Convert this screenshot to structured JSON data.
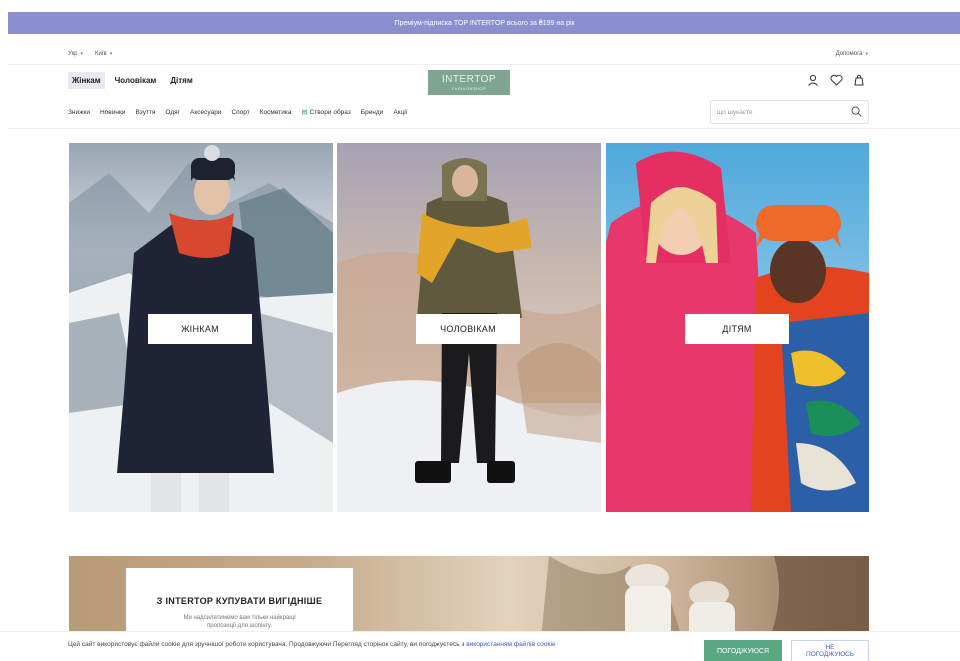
{
  "promo_bar": {
    "text": "Преміум-підписка TOP INTERTOP всього за ₴199 на рік"
  },
  "topbar": {
    "language": "Укр",
    "city": "Київ",
    "help": "Допомога"
  },
  "gender_nav": [
    {
      "label": "Жінкам",
      "active": true
    },
    {
      "label": "Чоловікам",
      "active": false
    },
    {
      "label": "Дітям",
      "active": false
    }
  ],
  "logo": {
    "main": "INTERTOP",
    "sub": "FASHIONSHOP"
  },
  "header_icons": [
    "user-icon",
    "heart-icon",
    "bag-icon"
  ],
  "categories": [
    "Знижки",
    "Новинки",
    "Взуття",
    "Одяг",
    "Аксесуари",
    "Спорт",
    "Косметика",
    "Створи образ",
    "Бренди",
    "Акції"
  ],
  "search": {
    "placeholder": "що шукаєте"
  },
  "tiles": [
    {
      "label": "ЖІНКАМ"
    },
    {
      "label": "ЧОЛОВІКАМ"
    },
    {
      "label": "ДІТЯМ"
    }
  ],
  "banner": {
    "title": "З INTERTOP КУПУВАТИ ВИГІДНІШЕ",
    "subtitle": "Ми надсилатимемо вам тільки найкращі пропозиції для шопінгу."
  },
  "cookie": {
    "text": "Цей сайт використовує файли cookie для зручнішої роботи користувача. Продовжуючи Перегляд сторінок сайту, ви погоджуєтесь з",
    "link": "використанням файлів cookie",
    "accept_label": "ПОГОДЖУЮСЯ",
    "decline_line1": "НЕ",
    "decline_line2": "ПОГОДЖУЮСЬ"
  },
  "colors": {
    "promo": "#8b8fd0",
    "logo": "#7da591",
    "accept": "#5aa882",
    "link": "#3a5bd9"
  }
}
